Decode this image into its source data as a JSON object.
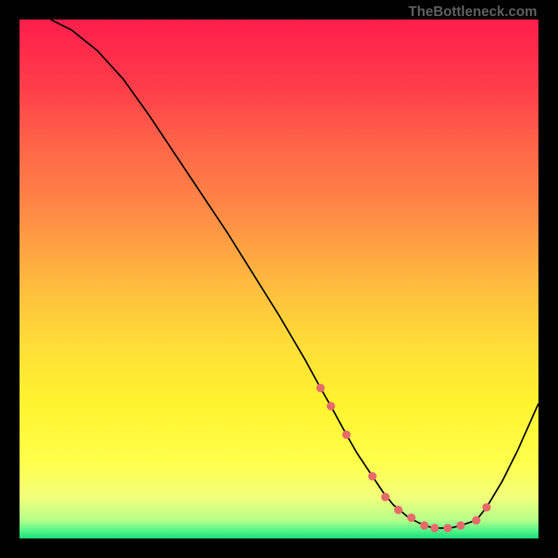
{
  "watermark": "TheBottleneck.com",
  "chart_data": {
    "type": "line",
    "title": "",
    "xlabel": "",
    "ylabel": "",
    "xlim": [
      0,
      100
    ],
    "ylim": [
      0,
      100
    ],
    "curve": {
      "x": [
        6,
        10,
        15,
        20,
        25,
        30,
        35,
        40,
        45,
        50,
        55,
        58,
        60,
        63,
        65,
        68,
        70,
        72,
        75,
        78,
        80,
        83,
        85,
        88,
        90,
        93,
        96,
        100
      ],
      "y": [
        100,
        98,
        94,
        88.5,
        81.5,
        74,
        66.5,
        59,
        51,
        43,
        34.5,
        29,
        25.5,
        20,
        16.5,
        12,
        9,
        6.5,
        4,
        2.5,
        2,
        2,
        2.5,
        3.5,
        6,
        11,
        17,
        26
      ]
    },
    "markers": {
      "x": [
        58,
        60,
        63,
        68,
        70.5,
        73,
        75.5,
        78,
        80,
        82.5,
        85,
        88,
        90
      ],
      "y": [
        29,
        25.5,
        20,
        12,
        8,
        5.5,
        4,
        2.5,
        2,
        2,
        2.5,
        3.5,
        6
      ]
    },
    "gradient_stops": [
      {
        "offset": 0.0,
        "color": "#ff1e4b"
      },
      {
        "offset": 0.12,
        "color": "#ff3a4a"
      },
      {
        "offset": 0.25,
        "color": "#ff6748"
      },
      {
        "offset": 0.38,
        "color": "#ff8d45"
      },
      {
        "offset": 0.5,
        "color": "#ffb83f"
      },
      {
        "offset": 0.62,
        "color": "#ffdc38"
      },
      {
        "offset": 0.74,
        "color": "#fff32e"
      },
      {
        "offset": 0.85,
        "color": "#ffff4a"
      },
      {
        "offset": 0.92,
        "color": "#f2ff7a"
      },
      {
        "offset": 0.965,
        "color": "#b5ff8a"
      },
      {
        "offset": 0.985,
        "color": "#55f58a"
      },
      {
        "offset": 1.0,
        "color": "#17e07a"
      }
    ],
    "marker_color": "#e86a6a",
    "curve_color": "#000000"
  }
}
